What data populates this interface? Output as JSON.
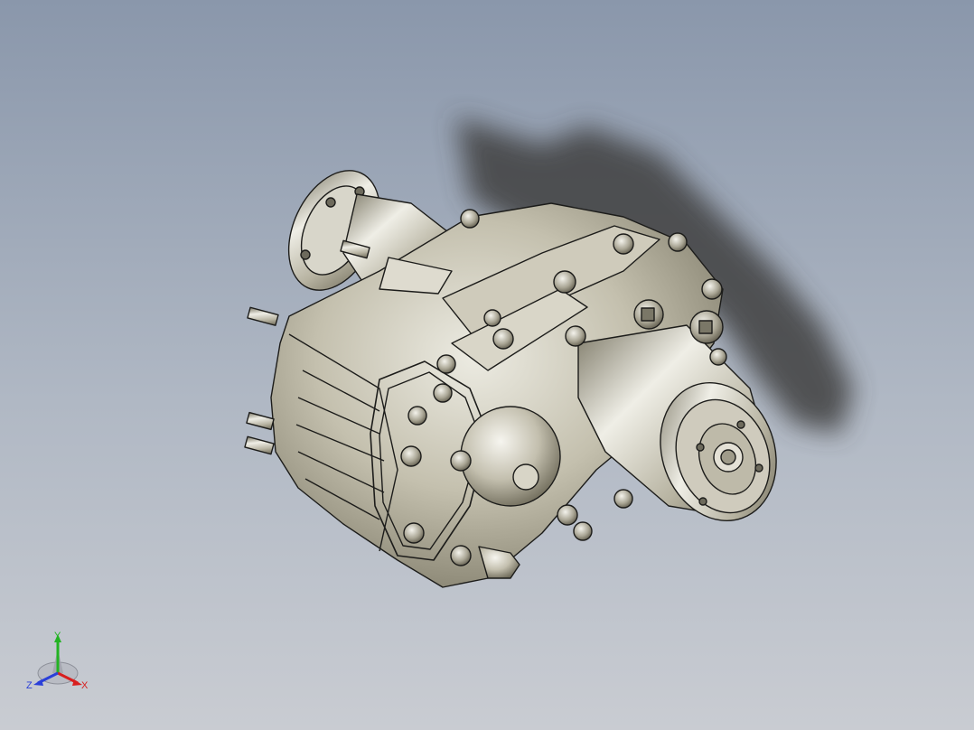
{
  "viewport": {
    "background_top": "#8c99ad",
    "background_bottom": "#c7cbd2",
    "model_metal_color": "#c9c5b4",
    "model_shadow_color": "#4f4f50",
    "edge_color": "#1c1c1a"
  },
  "triad": {
    "x_label": "X",
    "y_label": "Y",
    "z_label": "Z",
    "x_color": "#d81f1f",
    "y_color": "#23b323",
    "z_color": "#2a3fd9"
  }
}
